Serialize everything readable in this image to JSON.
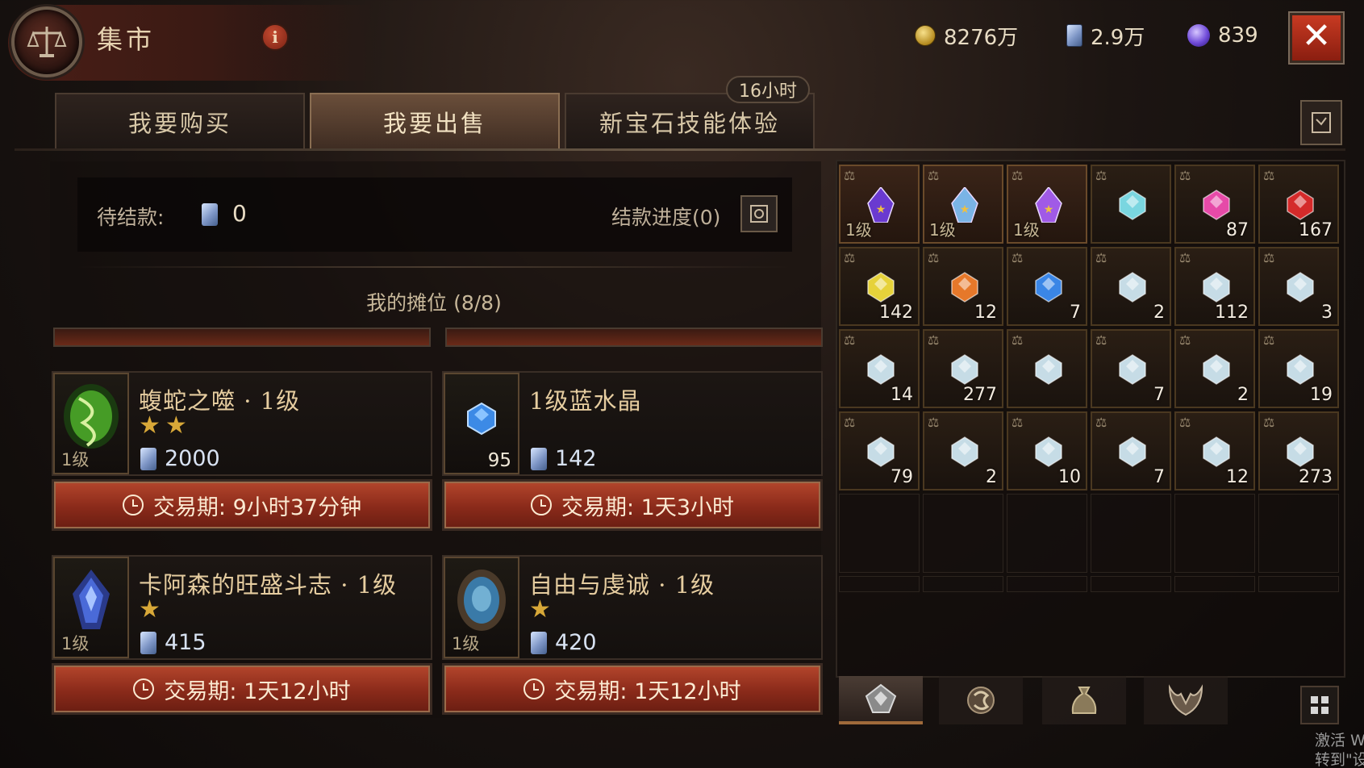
{
  "header": {
    "title": "集市",
    "currencies": [
      {
        "name": "gold",
        "value": "8276万"
      },
      {
        "name": "platinum",
        "value": "2.9万"
      },
      {
        "name": "orb",
        "value": "839"
      }
    ]
  },
  "tabs": [
    {
      "label": "我要购买",
      "active": false
    },
    {
      "label": "我要出售",
      "active": true
    },
    {
      "label": "新宝石技能体验",
      "active": false
    }
  ],
  "tab_badge": "16小时",
  "pending": {
    "label": "待结款:",
    "value": "0",
    "progress_label": "结款进度(0)"
  },
  "stall": {
    "title": "我的摊位 (8/8)"
  },
  "listings": [
    {
      "name": "蝮蛇之噬 · 1级",
      "stars": "★★",
      "level": "1级",
      "quantity": "",
      "price": "2000",
      "period": "交易期: 9小时37分钟",
      "gem_color": "#4fae2a"
    },
    {
      "name": "1级蓝水晶",
      "stars": "",
      "level": "",
      "quantity": "95",
      "price": "142",
      "period": "交易期: 1天3小时",
      "gem_color": "#3c8ae6"
    },
    {
      "name": "卡阿森的旺盛斗志 · 1级",
      "stars": "★",
      "level": "1级",
      "quantity": "",
      "price": "415",
      "period": "交易期: 1天12小时",
      "gem_color": "#4a6ad8"
    },
    {
      "name": "自由与虔诚 · 1级",
      "stars": "★",
      "level": "1级",
      "quantity": "",
      "price": "420",
      "period": "交易期: 1天12小时",
      "gem_color": "#3a7aa8"
    }
  ],
  "inventory": [
    {
      "qty": "",
      "level": "1级",
      "color": "#6a3ad0",
      "rare": true
    },
    {
      "qty": "",
      "level": "1级",
      "color": "#7ab4e6",
      "rare": true
    },
    {
      "qty": "",
      "level": "1级",
      "color": "#a05ae6",
      "rare": true
    },
    {
      "qty": "",
      "level": "",
      "color": "#7ad6e0",
      "rare": false
    },
    {
      "qty": "87",
      "level": "",
      "color": "#e64aa8",
      "rare": false
    },
    {
      "qty": "167",
      "level": "",
      "color": "#d42a2a",
      "rare": false
    },
    {
      "qty": "142",
      "level": "",
      "color": "#e6d23a",
      "rare": false
    },
    {
      "qty": "12",
      "level": "",
      "color": "#e6782a",
      "rare": false
    },
    {
      "qty": "7",
      "level": "",
      "color": "#3a86e6",
      "rare": false
    },
    {
      "qty": "2",
      "level": "",
      "color": "#c6dce6",
      "rare": false
    },
    {
      "qty": "112",
      "level": "",
      "color": "#c6dce6",
      "rare": false
    },
    {
      "qty": "3",
      "level": "",
      "color": "#c6dce6",
      "rare": false
    },
    {
      "qty": "14",
      "level": "",
      "color": "#c6dce6",
      "rare": false
    },
    {
      "qty": "277",
      "level": "",
      "color": "#c6dce6",
      "rare": false
    },
    {
      "qty": "",
      "level": "",
      "color": "#c6dce6",
      "rare": false
    },
    {
      "qty": "7",
      "level": "",
      "color": "#c6dce6",
      "rare": false
    },
    {
      "qty": "2",
      "level": "",
      "color": "#c6dce6",
      "rare": false
    },
    {
      "qty": "19",
      "level": "",
      "color": "#c6dce6",
      "rare": false
    },
    {
      "qty": "79",
      "level": "",
      "color": "#c6dce6",
      "rare": false
    },
    {
      "qty": "2",
      "level": "",
      "color": "#c6dce6",
      "rare": false
    },
    {
      "qty": "10",
      "level": "",
      "color": "#c6dce6",
      "rare": false
    },
    {
      "qty": "7",
      "level": "",
      "color": "#c6dce6",
      "rare": false
    },
    {
      "qty": "12",
      "level": "",
      "color": "#c6dce6",
      "rare": false
    },
    {
      "qty": "273",
      "level": "",
      "color": "#c6dce6",
      "rare": false
    }
  ],
  "filters": [
    {
      "icon": "gem-filter-icon",
      "active": true
    },
    {
      "icon": "skill-filter-icon",
      "active": false
    },
    {
      "icon": "bag-filter-icon",
      "active": false
    },
    {
      "icon": "demon-filter-icon",
      "active": false
    }
  ],
  "watermark": {
    "line1": "激活 W",
    "line2": "转到\"设置"
  }
}
